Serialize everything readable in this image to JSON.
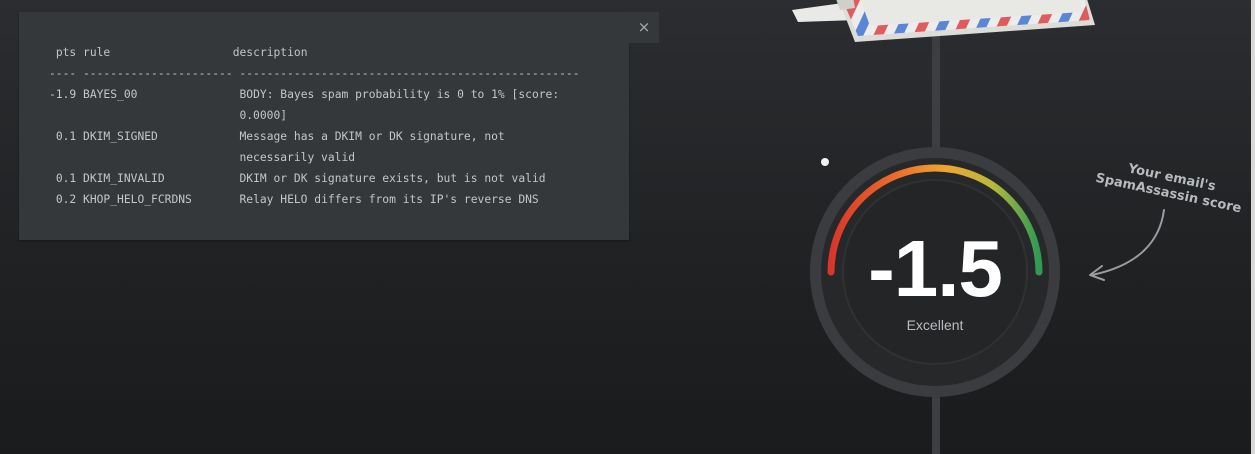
{
  "report": {
    "header": {
      "pts": "pts",
      "rule": "rule",
      "description": "description"
    },
    "separator": "---- ---------------------- --------------------------------------------------",
    "rows": [
      {
        "pts": "-1.9",
        "rule": "BAYES_00",
        "description": [
          "BODY: Bayes spam probability is 0 to 1% [score:",
          "0.0000]"
        ]
      },
      {
        "pts": "0.1",
        "rule": "DKIM_SIGNED",
        "description": [
          "Message has a DKIM or DK signature, not",
          "necessarily valid"
        ]
      },
      {
        "pts": "0.1",
        "rule": "DKIM_INVALID",
        "description": [
          "DKIM or DK signature exists, but is not valid"
        ]
      },
      {
        "pts": "0.2",
        "rule": "KHOP_HELO_FCRDNS",
        "description": [
          "Relay HELO differs from its IP's reverse DNS"
        ]
      }
    ]
  },
  "close_icon": "×",
  "score": {
    "value": "-1.5",
    "rating": "Excellent"
  },
  "annotation": {
    "line1": "Your email's",
    "line2": "SpamAssassin score"
  },
  "colors": {
    "gauge_start": "#d8362a",
    "gauge_mid": "#f0a631",
    "gauge_end": "#2e9a54",
    "panel": "#35383b"
  }
}
